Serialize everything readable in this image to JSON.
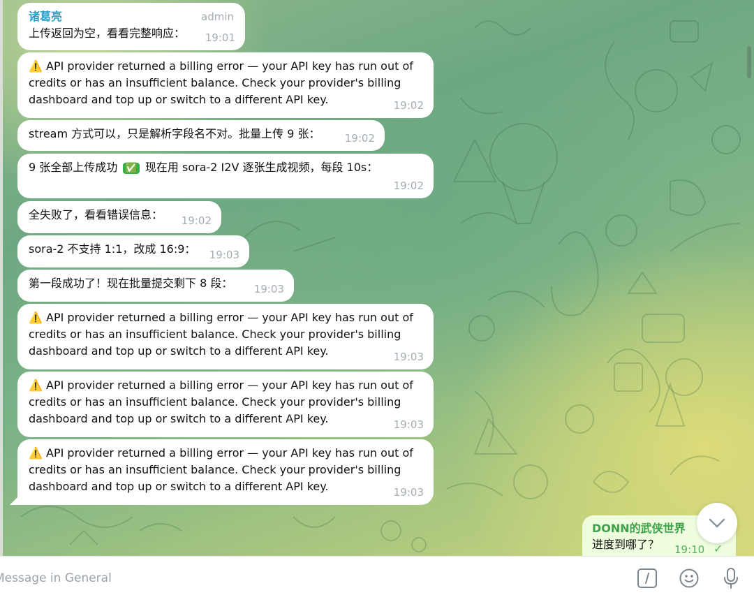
{
  "chat": {
    "group": "General",
    "messages": [
      {
        "sender": "诸葛亮",
        "role": "admin",
        "text": "上传返回为空，看看完整响应：",
        "time": "19:01"
      },
      {
        "warn": "⚠️",
        "text": "API provider returned a billing error — your API key has run out of credits or has an insufficient balance. Check your provider's billing dashboard and top up or switch to a different API key.",
        "time": "19:02"
      },
      {
        "text": "stream 方式可以，只是解析字段名不对。批量上传 9 张：",
        "time": "19:02"
      },
      {
        "text_a": "9 张全部上传成功",
        "check": "✅",
        "text_b": "现在用 sora-2 I2V 逐张生成视频，每段 10s：",
        "time": "19:02"
      },
      {
        "text": "全失败了，看看错误信息：",
        "time": "19:02"
      },
      {
        "text": "sora-2 不支持 1:1，改成 16:9：",
        "time": "19:03"
      },
      {
        "text": "第一段成功了！现在批量提交剩下 8 段：",
        "time": "19:03"
      },
      {
        "warn": "⚠️",
        "text": "API provider returned a billing error — your API key has run out of credits or has an insufficient balance. Check your provider's billing dashboard and top up or switch to a different API key.",
        "time": "19:03"
      },
      {
        "warn": "⚠️",
        "text": "API provider returned a billing error — your API key has run out of credits or has an insufficient balance. Check your provider's billing dashboard and top up or switch to a different API key.",
        "time": "19:03"
      },
      {
        "warn": "⚠️",
        "text": "API provider returned a billing error — your API key has run out of credits or has an insufficient balance. Check your provider's billing dashboard and top up or switch to a different API key.",
        "time": "19:03"
      }
    ],
    "own_message": {
      "sender": "DONN的武侠世界",
      "text": "进度到哪了？",
      "time": "19:10",
      "status": "✓"
    }
  },
  "composer": {
    "placeholder": "Message in General"
  },
  "icons": {
    "scroll_down": "chevron-down-icon",
    "commands": "slash-command-icon",
    "emoji": "emoji-icon",
    "voice": "microphone-icon"
  },
  "colors": {
    "sender": "#2aa0c8",
    "own_bubble": "#eefdde",
    "own_accent": "#4db35c"
  }
}
